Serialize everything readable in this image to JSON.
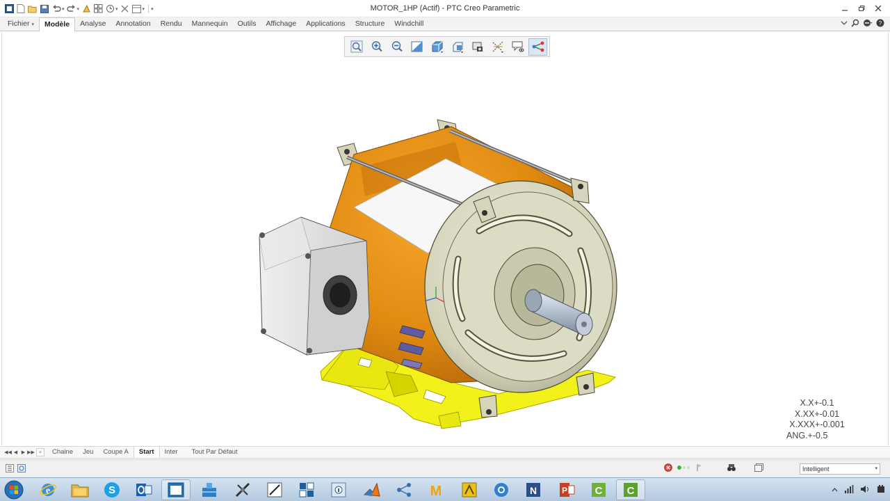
{
  "window": {
    "title": "MOTOR_1HP (Actif) - PTC Creo Parametric"
  },
  "ribbon": {
    "tabs": [
      {
        "label": "Fichier",
        "active": false,
        "dropdown": true
      },
      {
        "label": "Modèle",
        "active": true
      },
      {
        "label": "Analyse",
        "active": false
      },
      {
        "label": "Annotation",
        "active": false
      },
      {
        "label": "Rendu",
        "active": false
      },
      {
        "label": "Mannequin",
        "active": false
      },
      {
        "label": "Outils",
        "active": false
      },
      {
        "label": "Affichage",
        "active": false
      },
      {
        "label": "Applications",
        "active": false
      },
      {
        "label": "Structure",
        "active": false
      },
      {
        "label": "Windchill",
        "active": false
      }
    ]
  },
  "view_toolbar": {
    "buttons": [
      "refit-icon",
      "zoom-in-icon",
      "zoom-out-icon",
      "repaint-icon",
      "display-style-icon",
      "saved-orientations-icon",
      "view-manager-icon",
      "datum-display-icon",
      "annotation-display-icon",
      "spin-center-icon"
    ]
  },
  "tolerances": {
    "lines": [
      "X.X+-0.1",
      "X.XX+-0.01",
      "X.XXX+-0.001",
      "ANG.+-0.5"
    ]
  },
  "model_tabs": {
    "items": [
      {
        "label": "Chaine",
        "current": false
      },
      {
        "label": "Jeu",
        "current": false
      },
      {
        "label": "Coupe A",
        "current": false
      },
      {
        "label": "Start",
        "current": true
      },
      {
        "label": "Inter",
        "current": false
      },
      {
        "label": "Tout Par Défaut",
        "current": false
      }
    ]
  },
  "status_bar": {
    "selection_filter": "Intelligent"
  },
  "colors": {
    "housing": "#e08a10",
    "base": "#f2f21a",
    "endbell": "#d3d2b8",
    "box": "#dcdcdc"
  },
  "taskbar": {
    "apps": [
      "internet-explorer-icon",
      "file-explorer-icon",
      "skype-icon",
      "outlook-icon",
      "window-app-icon",
      "blue-tool-icon",
      "sketch-tool-icon",
      "pen-tool-icon",
      "grid-tool-icon",
      "info-tool-icon",
      "matlab-icon",
      "share-tool-icon",
      "mathcad-icon",
      "yellow-tool-icon",
      "chrome-like-icon",
      "onenote-icon",
      "powerpoint-icon",
      "creo-icon",
      "creo-parametric-icon"
    ]
  }
}
